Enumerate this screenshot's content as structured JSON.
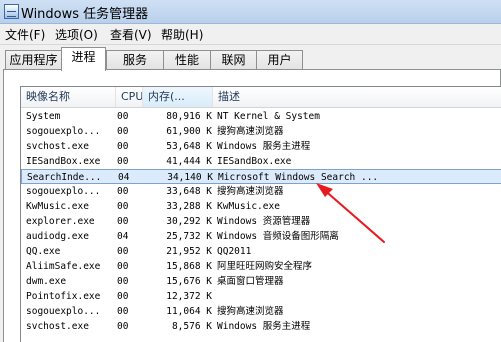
{
  "window": {
    "title": "Windows 任务管理器"
  },
  "menu": [
    {
      "label": "文件(F)"
    },
    {
      "label": "选项(O)"
    },
    {
      "label": "查看(V)"
    },
    {
      "label": "帮助(H)"
    }
  ],
  "tabs": [
    {
      "label": "应用程序",
      "active": false
    },
    {
      "label": "进程",
      "active": true
    },
    {
      "label": "服务",
      "active": false
    },
    {
      "label": "性能",
      "active": false
    },
    {
      "label": "联网",
      "active": false
    },
    {
      "label": "用户",
      "active": false
    }
  ],
  "table": {
    "columns": [
      {
        "label": "映像名称"
      },
      {
        "label": "CPU"
      },
      {
        "label": "内存(..."
      },
      {
        "label": "描述"
      }
    ],
    "rows": [
      {
        "name": "System",
        "cpu": "00",
        "mem": "80,916 K",
        "desc": "NT Kernel & System"
      },
      {
        "name": "sogouexplo...",
        "cpu": "00",
        "mem": "61,900 K",
        "desc": "搜狗高速浏览器"
      },
      {
        "name": "svchost.exe",
        "cpu": "00",
        "mem": "53,648 K",
        "desc": "Windows 服务主进程"
      },
      {
        "name": "IESandBox.exe",
        "cpu": "00",
        "mem": "41,444 K",
        "desc": "IESandBox.exe"
      },
      {
        "name": "SearchInde...",
        "cpu": "04",
        "mem": "34,140 K",
        "desc": "Microsoft Windows Search ...",
        "selected": true
      },
      {
        "name": "sogouexplo...",
        "cpu": "00",
        "mem": "33,648 K",
        "desc": "搜狗高速浏览器"
      },
      {
        "name": "KwMusic.exe",
        "cpu": "00",
        "mem": "33,288 K",
        "desc": "KwMusic.exe"
      },
      {
        "name": "explorer.exe",
        "cpu": "00",
        "mem": "30,292 K",
        "desc": "Windows 资源管理器"
      },
      {
        "name": "audiodg.exe",
        "cpu": "04",
        "mem": "25,732 K",
        "desc": "Windows 音频设备图形隔离"
      },
      {
        "name": "QQ.exe",
        "cpu": "00",
        "mem": "21,952 K",
        "desc": "QQ2011"
      },
      {
        "name": "AliimSafe.exe",
        "cpu": "00",
        "mem": "15,868 K",
        "desc": "阿里旺旺网购安全程序"
      },
      {
        "name": "dwm.exe",
        "cpu": "00",
        "mem": "15,676 K",
        "desc": "桌面窗口管理器"
      },
      {
        "name": "Pointofix.exe",
        "cpu": "00",
        "mem": "12,372 K",
        "desc": ""
      },
      {
        "name": "sogouexplo...",
        "cpu": "00",
        "mem": "11,064 K",
        "desc": "搜狗高速浏览器"
      },
      {
        "name": "svchost.exe",
        "cpu": "00",
        "mem": "8,576 K",
        "desc": "Windows 服务主进程"
      }
    ]
  },
  "colors": {
    "annotation_arrow": "#e8191f",
    "selection_bg": "#dcebfc"
  }
}
